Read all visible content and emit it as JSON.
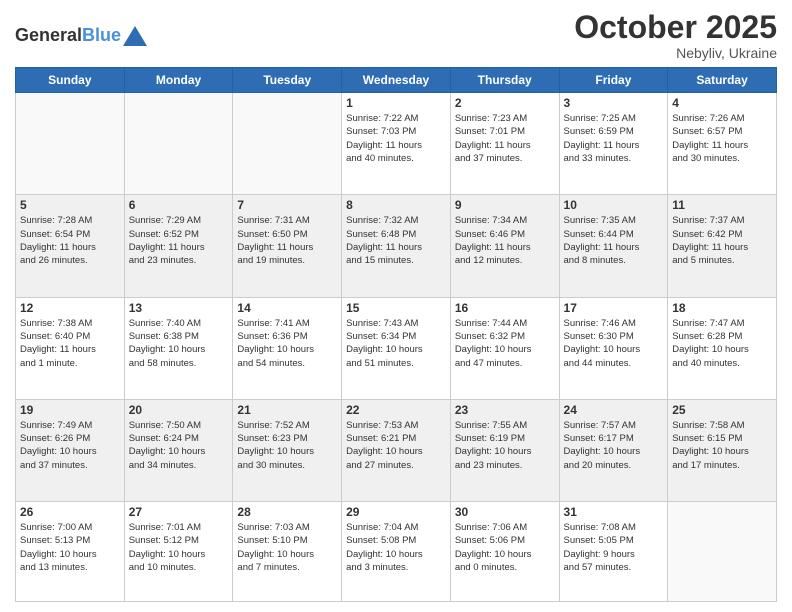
{
  "header": {
    "logo_line1": "General",
    "logo_line2": "Blue",
    "month": "October 2025",
    "location": "Nebyliv, Ukraine"
  },
  "weekdays": [
    "Sunday",
    "Monday",
    "Tuesday",
    "Wednesday",
    "Thursday",
    "Friday",
    "Saturday"
  ],
  "weeks": [
    [
      {
        "day": "",
        "info": ""
      },
      {
        "day": "",
        "info": ""
      },
      {
        "day": "",
        "info": ""
      },
      {
        "day": "1",
        "info": "Sunrise: 7:22 AM\nSunset: 7:03 PM\nDaylight: 11 hours\nand 40 minutes."
      },
      {
        "day": "2",
        "info": "Sunrise: 7:23 AM\nSunset: 7:01 PM\nDaylight: 11 hours\nand 37 minutes."
      },
      {
        "day": "3",
        "info": "Sunrise: 7:25 AM\nSunset: 6:59 PM\nDaylight: 11 hours\nand 33 minutes."
      },
      {
        "day": "4",
        "info": "Sunrise: 7:26 AM\nSunset: 6:57 PM\nDaylight: 11 hours\nand 30 minutes."
      }
    ],
    [
      {
        "day": "5",
        "info": "Sunrise: 7:28 AM\nSunset: 6:54 PM\nDaylight: 11 hours\nand 26 minutes."
      },
      {
        "day": "6",
        "info": "Sunrise: 7:29 AM\nSunset: 6:52 PM\nDaylight: 11 hours\nand 23 minutes."
      },
      {
        "day": "7",
        "info": "Sunrise: 7:31 AM\nSunset: 6:50 PM\nDaylight: 11 hours\nand 19 minutes."
      },
      {
        "day": "8",
        "info": "Sunrise: 7:32 AM\nSunset: 6:48 PM\nDaylight: 11 hours\nand 15 minutes."
      },
      {
        "day": "9",
        "info": "Sunrise: 7:34 AM\nSunset: 6:46 PM\nDaylight: 11 hours\nand 12 minutes."
      },
      {
        "day": "10",
        "info": "Sunrise: 7:35 AM\nSunset: 6:44 PM\nDaylight: 11 hours\nand 8 minutes."
      },
      {
        "day": "11",
        "info": "Sunrise: 7:37 AM\nSunset: 6:42 PM\nDaylight: 11 hours\nand 5 minutes."
      }
    ],
    [
      {
        "day": "12",
        "info": "Sunrise: 7:38 AM\nSunset: 6:40 PM\nDaylight: 11 hours\nand 1 minute."
      },
      {
        "day": "13",
        "info": "Sunrise: 7:40 AM\nSunset: 6:38 PM\nDaylight: 10 hours\nand 58 minutes."
      },
      {
        "day": "14",
        "info": "Sunrise: 7:41 AM\nSunset: 6:36 PM\nDaylight: 10 hours\nand 54 minutes."
      },
      {
        "day": "15",
        "info": "Sunrise: 7:43 AM\nSunset: 6:34 PM\nDaylight: 10 hours\nand 51 minutes."
      },
      {
        "day": "16",
        "info": "Sunrise: 7:44 AM\nSunset: 6:32 PM\nDaylight: 10 hours\nand 47 minutes."
      },
      {
        "day": "17",
        "info": "Sunrise: 7:46 AM\nSunset: 6:30 PM\nDaylight: 10 hours\nand 44 minutes."
      },
      {
        "day": "18",
        "info": "Sunrise: 7:47 AM\nSunset: 6:28 PM\nDaylight: 10 hours\nand 40 minutes."
      }
    ],
    [
      {
        "day": "19",
        "info": "Sunrise: 7:49 AM\nSunset: 6:26 PM\nDaylight: 10 hours\nand 37 minutes."
      },
      {
        "day": "20",
        "info": "Sunrise: 7:50 AM\nSunset: 6:24 PM\nDaylight: 10 hours\nand 34 minutes."
      },
      {
        "day": "21",
        "info": "Sunrise: 7:52 AM\nSunset: 6:23 PM\nDaylight: 10 hours\nand 30 minutes."
      },
      {
        "day": "22",
        "info": "Sunrise: 7:53 AM\nSunset: 6:21 PM\nDaylight: 10 hours\nand 27 minutes."
      },
      {
        "day": "23",
        "info": "Sunrise: 7:55 AM\nSunset: 6:19 PM\nDaylight: 10 hours\nand 23 minutes."
      },
      {
        "day": "24",
        "info": "Sunrise: 7:57 AM\nSunset: 6:17 PM\nDaylight: 10 hours\nand 20 minutes."
      },
      {
        "day": "25",
        "info": "Sunrise: 7:58 AM\nSunset: 6:15 PM\nDaylight: 10 hours\nand 17 minutes."
      }
    ],
    [
      {
        "day": "26",
        "info": "Sunrise: 7:00 AM\nSunset: 5:13 PM\nDaylight: 10 hours\nand 13 minutes."
      },
      {
        "day": "27",
        "info": "Sunrise: 7:01 AM\nSunset: 5:12 PM\nDaylight: 10 hours\nand 10 minutes."
      },
      {
        "day": "28",
        "info": "Sunrise: 7:03 AM\nSunset: 5:10 PM\nDaylight: 10 hours\nand 7 minutes."
      },
      {
        "day": "29",
        "info": "Sunrise: 7:04 AM\nSunset: 5:08 PM\nDaylight: 10 hours\nand 3 minutes."
      },
      {
        "day": "30",
        "info": "Sunrise: 7:06 AM\nSunset: 5:06 PM\nDaylight: 10 hours\nand 0 minutes."
      },
      {
        "day": "31",
        "info": "Sunrise: 7:08 AM\nSunset: 5:05 PM\nDaylight: 9 hours\nand 57 minutes."
      },
      {
        "day": "",
        "info": ""
      }
    ]
  ]
}
